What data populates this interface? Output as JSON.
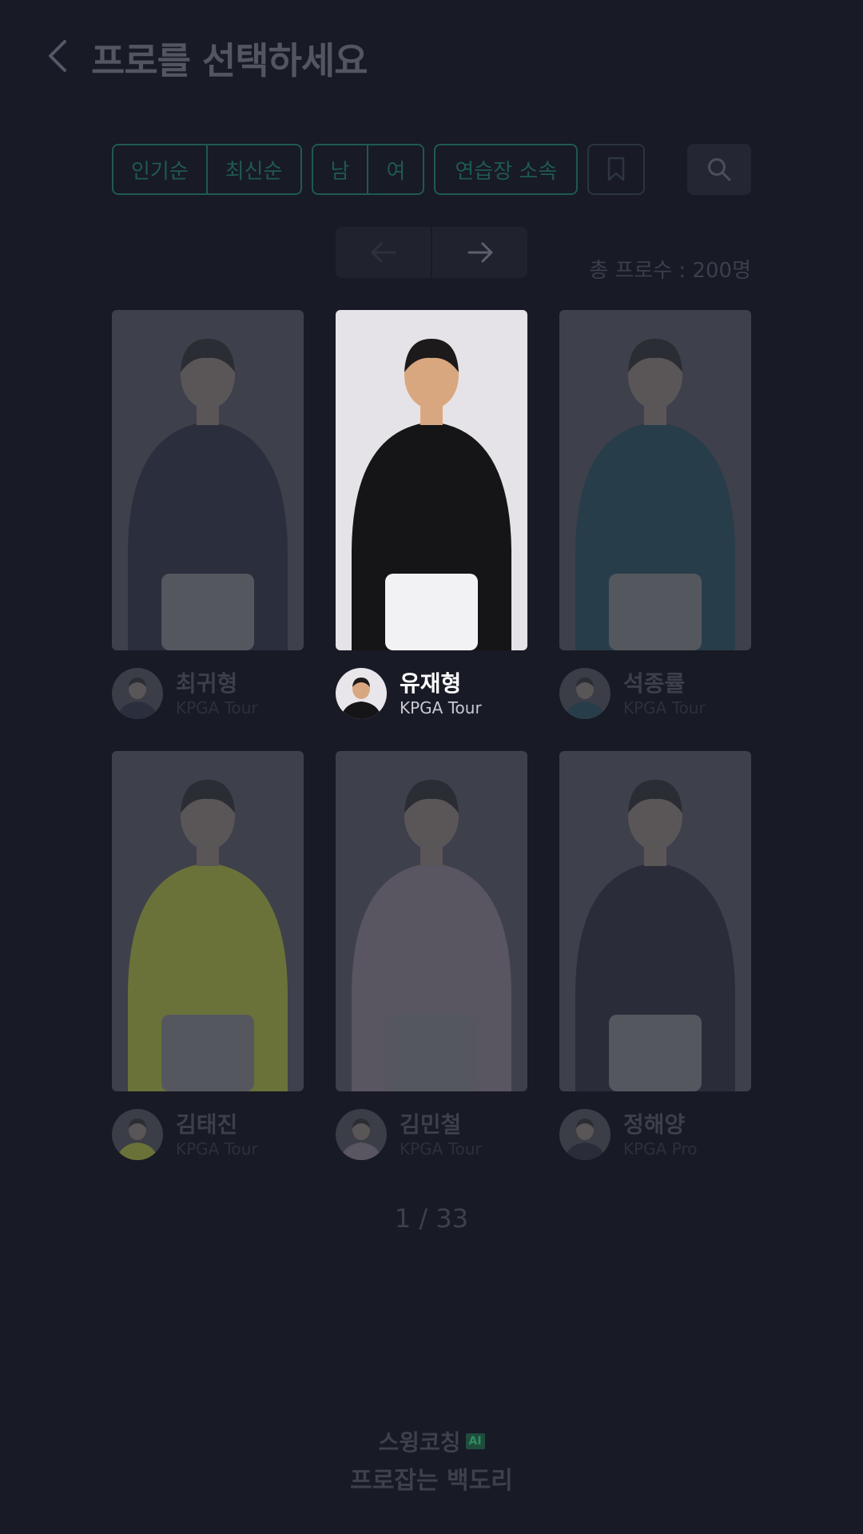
{
  "header": {
    "title": "프로를 선택하세요",
    "back_icon": "chevron-left-icon"
  },
  "filters": {
    "sort": [
      "인기순",
      "최신순"
    ],
    "gender": [
      "남",
      "여"
    ],
    "affiliation": "연습장 소속",
    "bookmark_icon": "bookmark-icon",
    "search_icon": "search-icon"
  },
  "pager": {
    "prev_icon": "arrow-left-icon",
    "next_icon": "arrow-right-icon"
  },
  "total_label": "총 프로수 : 200명",
  "pros": [
    {
      "name": "최귀형",
      "tour": "KPGA Tour",
      "shirt": "#1c2131",
      "active": false
    },
    {
      "name": "유재형",
      "tour": "KPGA Tour",
      "shirt": "#151517",
      "active": true
    },
    {
      "name": "석종률",
      "tour": "KPGA Tour",
      "shirt": "#163a49",
      "active": false
    },
    {
      "name": "김태진",
      "tour": "KPGA Tour",
      "shirt": "#8e9a2a",
      "active": false
    },
    {
      "name": "김민철",
      "tour": "KPGA Tour",
      "shirt": "#6f6773",
      "active": false
    },
    {
      "name": "정해양",
      "tour": "KPGA Pro",
      "shirt": "#1a1d2b",
      "active": false
    }
  ],
  "page_indicator": "1 / 33",
  "footer": {
    "line1": "스윙코칭",
    "badge": "AI",
    "line2": "프로잡는 백도리"
  },
  "colors": {
    "background": "#181a25",
    "accent": "#1f5a4e",
    "card_dim": "#3e404b"
  }
}
